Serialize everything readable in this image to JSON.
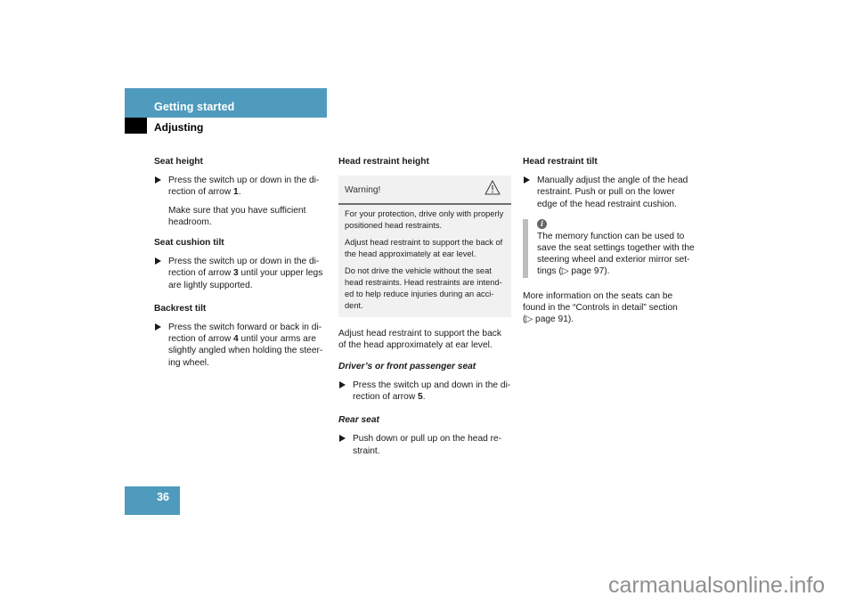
{
  "header": {
    "section": "Getting started",
    "subsection": "Adjusting"
  },
  "column1": {
    "seat_height": {
      "heading": "Seat height",
      "bullet": "Press the switch up or down in the di-rection of arrow",
      "bullet_line1": "Press the switch up or down in the di-",
      "bullet_line2_pre": "rection of arrow ",
      "bullet_num": "1",
      "bullet_line2_post": ".",
      "note_line1": "Make sure that you have sufficient",
      "note_line2": "headroom."
    },
    "seat_cushion_tilt": {
      "heading": "Seat cushion tilt",
      "bullet_line1": "Press the switch up or down in the di-",
      "bullet_line2_pre": "rection of arrow ",
      "bullet_num": "3",
      "bullet_line2_post": " until your upper legs",
      "bullet_line3": "are lightly supported."
    },
    "backrest_tilt": {
      "heading": "Backrest tilt",
      "bullet_line1": "Press the switch forward or back in di-",
      "bullet_line2_pre": "rection of arrow ",
      "bullet_num": "4",
      "bullet_line2_post": " until your arms are",
      "bullet_line3": "slightly angled when holding the steer-",
      "bullet_line4": "ing wheel."
    }
  },
  "column2": {
    "heading": "Head restraint height",
    "warning": {
      "title": "Warning!",
      "icon": "warning-triangle-icon",
      "p1_line1": "For your protection, drive only with properly",
      "p1_line2": "positioned head restraints.",
      "p2_line1": "Adjust head restraint to support the back of",
      "p2_line2": "the head approximately at ear level.",
      "p3_line1": "Do not drive the vehicle without the seat",
      "p3_line2": "head restraints. Head restraints are intend-",
      "p3_line3": "ed to help reduce injuries during an acci-",
      "p3_line4": "dent."
    },
    "intro_line1": "Adjust head restraint to support the back",
    "intro_line2": "of the head approximately at ear level.",
    "front_seat": {
      "heading": "Driver’s or front passenger seat",
      "bullet_line1": "Press the switch up and down in the di-",
      "bullet_line2_pre": "rection of arrow ",
      "bullet_num": "5",
      "bullet_line2_post": "."
    },
    "rear_seat": {
      "heading": "Rear seat",
      "bullet_line1": "Push down or pull up on the head re-",
      "bullet_line2": "straint."
    }
  },
  "column3": {
    "heading": "Head restraint tilt",
    "bullet_line1": "Manually adjust the angle of the head",
    "bullet_line2": "restraint. Push or pull on the lower",
    "bullet_line3": "edge of the head restraint cushion.",
    "info": {
      "icon": "info-icon",
      "icon_glyph": "i",
      "line1": "The memory function can be used to",
      "line2": "save the seat settings together with the",
      "line3": "steering wheel and exterior mirror set-",
      "line4": "tings (▷ page 97)."
    },
    "more_line1": "More information on the seats can be",
    "more_line2": "found in the “Controls in detail” section",
    "more_line3": "(▷ page 91)."
  },
  "footer": {
    "page_number": "36",
    "watermark": "carmanualsonline.info"
  },
  "colors": {
    "accent_blue": "#4f9bbd",
    "warning_bg": "#f1f1f1",
    "info_bar": "#bdbdbd"
  }
}
